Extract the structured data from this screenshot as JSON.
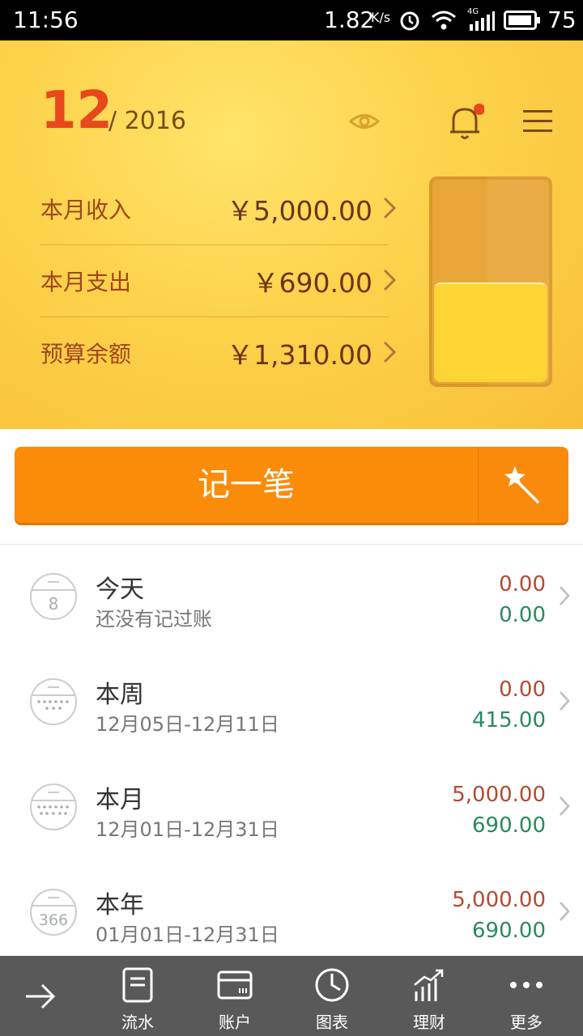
{
  "status_bar": {
    "time": "11:56",
    "speed": "1.82",
    "speed_unit": "K/s",
    "network": "4G",
    "battery": "75"
  },
  "header": {
    "month": "12",
    "year": "/ 2016",
    "rows": [
      {
        "label": "本月收入",
        "amount": "￥5,000.00"
      },
      {
        "label": "本月支出",
        "amount": "￥690.00"
      },
      {
        "label": "预算余额",
        "amount": "￥1,310.00"
      }
    ],
    "budget_fill_fraction": 0.5
  },
  "actions": {
    "record_label": "记一笔"
  },
  "summary_list": [
    {
      "title": "今天",
      "subtitle": "还没有记过账",
      "income": "0.00",
      "expense": "0.00",
      "icon_text": "8"
    },
    {
      "title": "本周",
      "subtitle": "12月05日-12月11日",
      "income": "0.00",
      "expense": "415.00",
      "icon_text": ""
    },
    {
      "title": "本月",
      "subtitle": "12月01日-12月31日",
      "income": "5,000.00",
      "expense": "690.00",
      "icon_text": ""
    },
    {
      "title": "本年",
      "subtitle": "01月01日-12月31日",
      "income": "5,000.00",
      "expense": "690.00",
      "icon_text": "366"
    }
  ],
  "bottom_nav": {
    "items": [
      {
        "label": "",
        "icon": "arrow-right-icon"
      },
      {
        "label": "流水",
        "icon": "note-icon"
      },
      {
        "label": "账户",
        "icon": "wallet-icon"
      },
      {
        "label": "图表",
        "icon": "pie-chart-icon"
      },
      {
        "label": "理财",
        "icon": "growth-chart-icon"
      },
      {
        "label": "更多",
        "icon": "more-dots-icon"
      }
    ]
  },
  "colors": {
    "header_bg": "#fdd24a",
    "accent_orange": "#fb8c0a",
    "income_red": "#b44a33",
    "expense_green": "#2b8a5b",
    "nav_bg": "#595959"
  }
}
